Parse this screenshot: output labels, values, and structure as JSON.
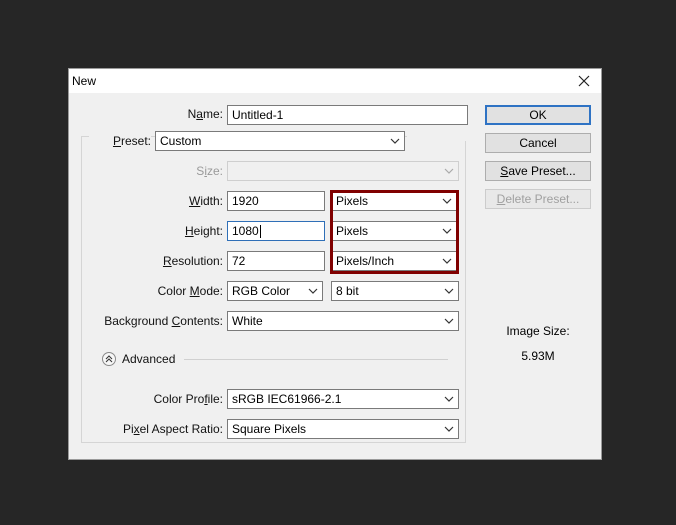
{
  "dialog": {
    "title": "New",
    "close_icon": "close-icon"
  },
  "form": {
    "name_label_pre": "N",
    "name_label_u": "a",
    "name_label_post": "me:",
    "name_value": "Untitled-1",
    "preset_label_pre": "",
    "preset_label_u": "P",
    "preset_label_post": "reset:",
    "preset_value": "Custom",
    "size_label_pre": "S",
    "size_label_u": "i",
    "size_label_post": "ze:",
    "size_value": "",
    "width_label_pre": "",
    "width_label_u": "W",
    "width_label_post": "idth:",
    "width_value": "1920",
    "width_unit": "Pixels",
    "height_label_pre": "",
    "height_label_u": "H",
    "height_label_post": "eight:",
    "height_value": "1080",
    "height_unit": "Pixels",
    "resolution_label_pre": "",
    "resolution_label_u": "R",
    "resolution_label_post": "esolution:",
    "resolution_value": "72",
    "resolution_unit": "Pixels/Inch",
    "color_mode_label_pre": "Color ",
    "color_mode_label_u": "M",
    "color_mode_label_post": "ode:",
    "color_mode_value": "RGB Color",
    "bit_depth_value": "8 bit",
    "background_label_pre": "Background ",
    "background_label_u": "C",
    "background_label_post": "ontents:",
    "background_value": "White",
    "advanced_label": "Advanced",
    "color_profile_label_pre": "Color Pro",
    "color_profile_label_u": "f",
    "color_profile_label_post": "ile:",
    "color_profile_value": "sRGB IEC61966-2.1",
    "pixel_aspect_label_pre": "Pi",
    "pixel_aspect_label_u": "x",
    "pixel_aspect_label_post": "el Aspect Ratio:",
    "pixel_aspect_value": "Square Pixels"
  },
  "buttons": {
    "ok": "OK",
    "cancel": "Cancel",
    "save_preset_u": "S",
    "save_preset_post": "ave Preset...",
    "delete_preset_u": "D",
    "delete_preset_post": "elete Preset..."
  },
  "image_size": {
    "label": "Image Size:",
    "value": "5.93M"
  },
  "colors": {
    "background": "#262626",
    "dialog": "#f0f0f0",
    "highlight": "#800000",
    "default_button_border": "#2f73c4"
  }
}
